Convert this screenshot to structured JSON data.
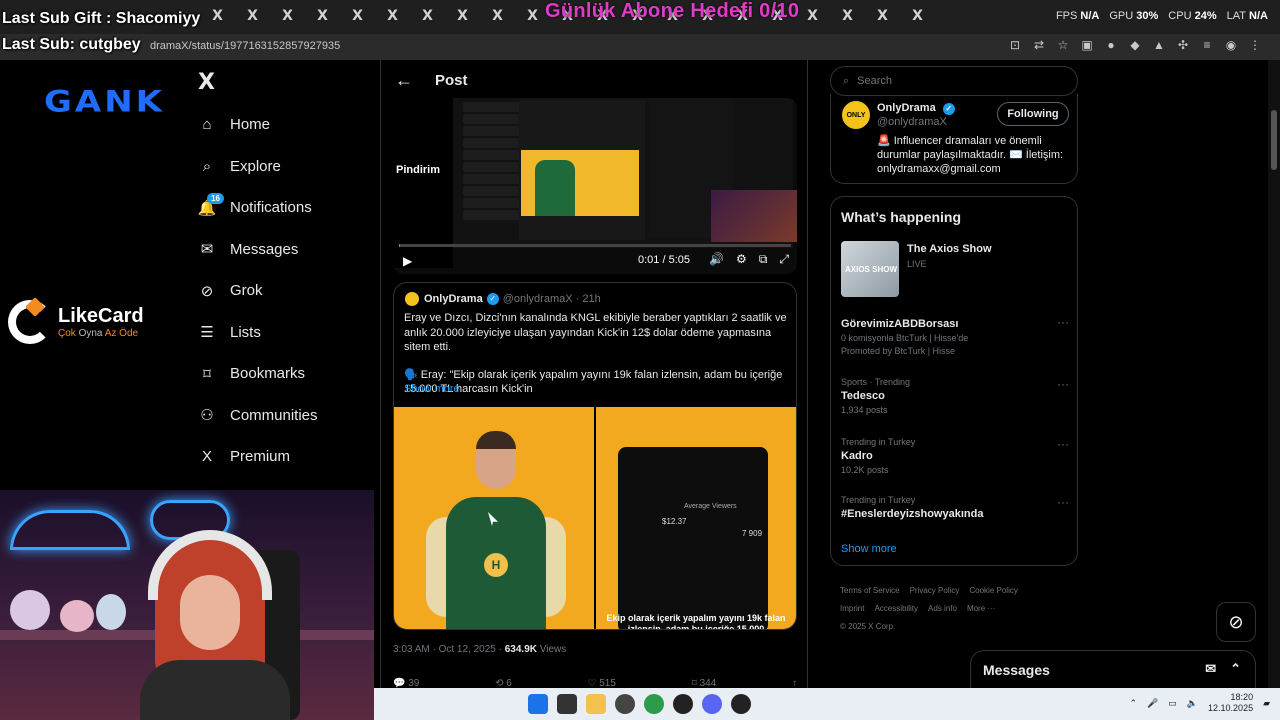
{
  "browser": {
    "tab_glyph": "X",
    "tab_close": "×",
    "tab_count": 21,
    "url": "dramaX/status/1977163152857927935",
    "stats": {
      "fps_label": "FPS",
      "fps": "N/A",
      "gpu_label": "GPU",
      "gpu": "30%",
      "cpu_label": "CPU",
      "cpu": "24%",
      "lat_label": "LAT",
      "lat": "N/A"
    }
  },
  "overlay": {
    "goal": "Günlük Abone Hedefi 0/10",
    "last_sub_gift": "Last Sub Gift : Shacomiyy",
    "last_sub": "Last Sub: cutgbey",
    "gank_logo": "GANK",
    "likecard_name": "LikeCard",
    "likecard_tag_a": "Çok",
    "likecard_tag_b": "Oyna",
    "likecard_tag_c": "Az Öde"
  },
  "sidebar": {
    "logo": "X",
    "items": [
      {
        "label": "Home",
        "icon": "home-icon"
      },
      {
        "label": "Explore",
        "icon": "search-icon"
      },
      {
        "label": "Notifications",
        "icon": "bell-icon",
        "badge": "16"
      },
      {
        "label": "Messages",
        "icon": "mail-icon"
      },
      {
        "label": "Grok",
        "icon": "grok-icon"
      },
      {
        "label": "Lists",
        "icon": "list-icon"
      },
      {
        "label": "Bookmarks",
        "icon": "bookmark-icon"
      },
      {
        "label": "Communities",
        "icon": "people-icon"
      },
      {
        "label": "Premium",
        "icon": "x-icon"
      }
    ]
  },
  "post": {
    "title": "Post",
    "video": {
      "brand": "Pindirim",
      "time": "0:01 / 5:05",
      "progress": 0.003
    },
    "quote": {
      "name": "OnlyDrama",
      "handle": "@onlydramaX · 21h",
      "p1": "Eray ve Dızcı, Dizci'nın kanalında KNGL ekibiyle beraber yaptıkları 2 saatlik ve anlık 20.000 izleyiciye ulaşan yayından Kick'in 12$ dolar ödeme yapmasına sitem etti.",
      "p2": "🗣️ Eray: \"Ekip olarak içerik yapalım yayını 19k falan izlensin, adam bu içeriğe 15.000 TL harcasın Kick'in",
      "show_more": "Show more",
      "media_stat_label": "Average Viewers",
      "media_stat_value": "$12.37",
      "media_viewers": "7 909",
      "media_caption": "Ekip olarak içerik yapalım yayını 19k falan izlensin, adam bu içeriğe 15.000",
      "jacket_badge": "H"
    },
    "meta_time": "3:03 AM · Oct 12, 2025 · ",
    "views": "634.9K",
    "views_label": " Views",
    "actions": {
      "replies": "39",
      "reposts": "6",
      "likes": "515",
      "bookmarks": "344"
    }
  },
  "right": {
    "search_placeholder": "Search",
    "profile": {
      "name": "OnlyDrama",
      "handle": "@onlydramaX",
      "avatar_text": "ONLY DRAMA",
      "follow_label": "Following",
      "bio": "🚨 Influencer dramaları ve önemli durumlar paylaşılmaktadır. ✉️ İletişim: onlydramaxx@gmail.com"
    },
    "happening": {
      "title": "What’s happening",
      "live": {
        "name": "The Axios Show",
        "status": "LIVE",
        "thumb_text": "AXIOS SHOW"
      },
      "trends": [
        {
          "context": "",
          "name": "GörevimizABDBorsası",
          "count": "0 komisyonla BtcTurk | Hisse'de",
          "promo": "Promoted by BtcTurk | Hisse"
        },
        {
          "context": "Sports · Trending",
          "name": "Tedesco",
          "count": "1,934 posts"
        },
        {
          "context": "Trending in Turkey",
          "name": "Kadro",
          "count": "10.2K posts"
        },
        {
          "context": "Trending in Turkey",
          "name": "#Eneslerdeyizshowyakında",
          "count": ""
        }
      ],
      "show_more": "Show more"
    },
    "footer": [
      "Terms of Service",
      "Privacy Policy",
      "Cookie Policy",
      "Imprint",
      "Accessibility",
      "Ads info",
      "More ···",
      "© 2025 X Corp."
    ]
  },
  "messages_drawer": {
    "label": "Messages"
  },
  "taskbar": {
    "time": "18:20",
    "date": "12.10.2025"
  },
  "colors": {
    "accent": "#1d9bf0",
    "background": "#000000",
    "goal": "#e03ac9",
    "gank": "#1f6dff"
  }
}
